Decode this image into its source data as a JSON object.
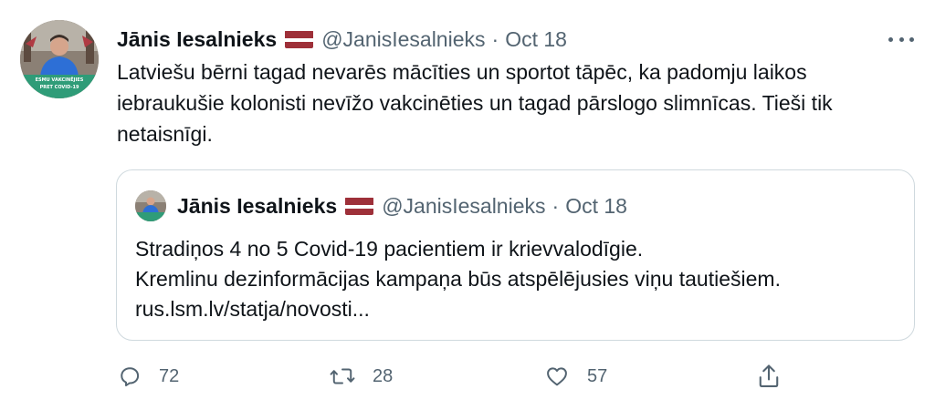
{
  "tweet": {
    "author_name": "Jānis Iesalnieks",
    "handle": "@JanisIesalnieks",
    "separator": "·",
    "date": "Oct 18",
    "avatar_caption_line1": "ESMU VAKCINĒJIES",
    "avatar_caption_line2": "PRET COVID-19",
    "text": "Latviešu bērni tagad nevarēs mācīties un sportot tāpēc, ka padomju laikos iebraukušie kolonisti nevīžo vakcinēties un tagad pārslogo slimnīcas. Tieši tik netaisnīgi."
  },
  "quoted_tweet": {
    "author_name": "Jānis Iesalnieks",
    "handle": "@JanisIesalnieks",
    "separator": "·",
    "date": "Oct 18",
    "line1": "Stradiņos 4 no 5 Covid-19 pacientiem ir krievvalodīgie.",
    "line2": "Kremlinu dezinformācijas kampaņa būs atspēlējusies viņu tautiešiem.",
    "line3": "rus.lsm.lv/statja/novosti..."
  },
  "actions": {
    "reply_count": "72",
    "retweet_count": "28",
    "like_count": "57"
  },
  "icons": {
    "flag": "latvian-flag-icon",
    "more": "more-icon",
    "reply": "reply-icon",
    "retweet": "retweet-icon",
    "like": "like-icon",
    "share": "share-icon"
  },
  "colors": {
    "text": "#0f1419",
    "secondary": "#536471",
    "border": "#cfd9de",
    "flag_carmine": "#9e3039"
  }
}
